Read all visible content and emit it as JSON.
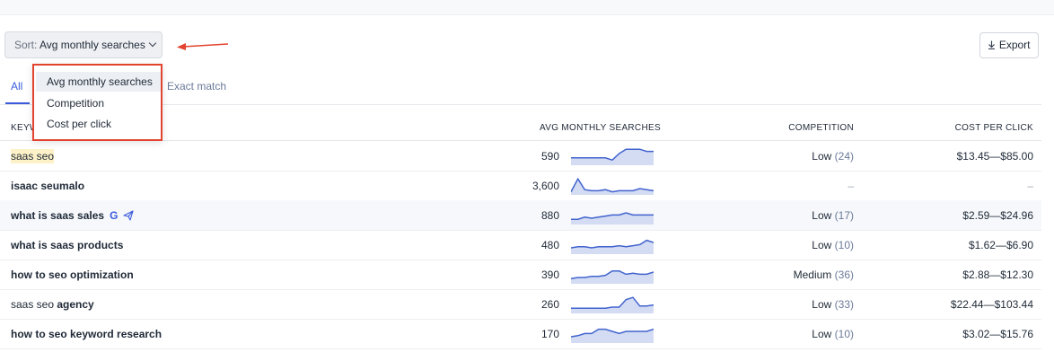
{
  "sort": {
    "prefix": "Sort:",
    "value": "Avg monthly searches"
  },
  "export_label": "Export",
  "tabs": [
    {
      "label": "All",
      "active": true
    },
    {
      "label": "Exact match",
      "active": false
    }
  ],
  "dropdown": {
    "options": [
      "Avg monthly searches",
      "Competition",
      "Cost per click"
    ],
    "selected": "Avg monthly searches"
  },
  "columns": {
    "keyword": "KEYW",
    "searches": "AVG MONTHLY SEARCHES",
    "competition": "COMPETITION",
    "cpc": "COST PER CLICK"
  },
  "rows": [
    {
      "keyword": "saas seo",
      "searches": "590",
      "competition": "Low",
      "competition_index": "(24)",
      "cpc": "$13.45—$85.00",
      "trend": [
        6,
        6,
        6,
        6,
        6,
        6,
        4,
        10,
        14,
        14,
        14,
        12,
        12
      ]
    },
    {
      "keyword": "isaac seumalo",
      "searches": "3,600",
      "competition": "–",
      "competition_index": "",
      "cpc": "–",
      "trend": [
        2,
        14,
        4,
        3,
        3,
        4,
        2,
        3,
        3,
        3,
        5,
        4,
        3
      ]
    },
    {
      "keyword": "what is saas sales",
      "searches": "880",
      "competition": "Low",
      "competition_index": "(17)",
      "cpc": "$2.59—$24.96",
      "trend": [
        4,
        4,
        6,
        5,
        6,
        7,
        8,
        8,
        10,
        8,
        8,
        8,
        8
      ]
    },
    {
      "keyword": "what is saas products",
      "searches": "480",
      "competition": "Low",
      "competition_index": "(10)",
      "cpc": "$1.62—$6.90",
      "trend": [
        5,
        6,
        6,
        5,
        6,
        6,
        6,
        7,
        6,
        7,
        8,
        12,
        10
      ]
    },
    {
      "keyword": "how to seo optimization",
      "searches": "390",
      "competition": "Medium",
      "competition_index": "(36)",
      "cpc": "$2.88—$12.30",
      "trend": [
        4,
        5,
        5,
        6,
        6,
        7,
        11,
        11,
        8,
        9,
        8,
        8,
        10
      ]
    },
    {
      "keyword": "saas seo agency",
      "searches": "260",
      "competition": "Low",
      "competition_index": "(33)",
      "cpc": "$22.44—$103.44",
      "trend": [
        4,
        4,
        4,
        4,
        4,
        4,
        5,
        5,
        12,
        14,
        6,
        6,
        7
      ]
    },
    {
      "keyword": "how to seo keyword research",
      "searches": "170",
      "competition": "Low",
      "competition_index": "(10)",
      "cpc": "$3.02—$15.76",
      "trend": [
        5,
        6,
        8,
        8,
        12,
        12,
        10,
        8,
        10,
        10,
        10,
        10,
        12
      ]
    }
  ],
  "colors": {
    "accent": "#3b5bdb",
    "highlight_border": "#e2442f",
    "spark_fill": "#d3dcf2",
    "spark_stroke": "#4263cf"
  }
}
